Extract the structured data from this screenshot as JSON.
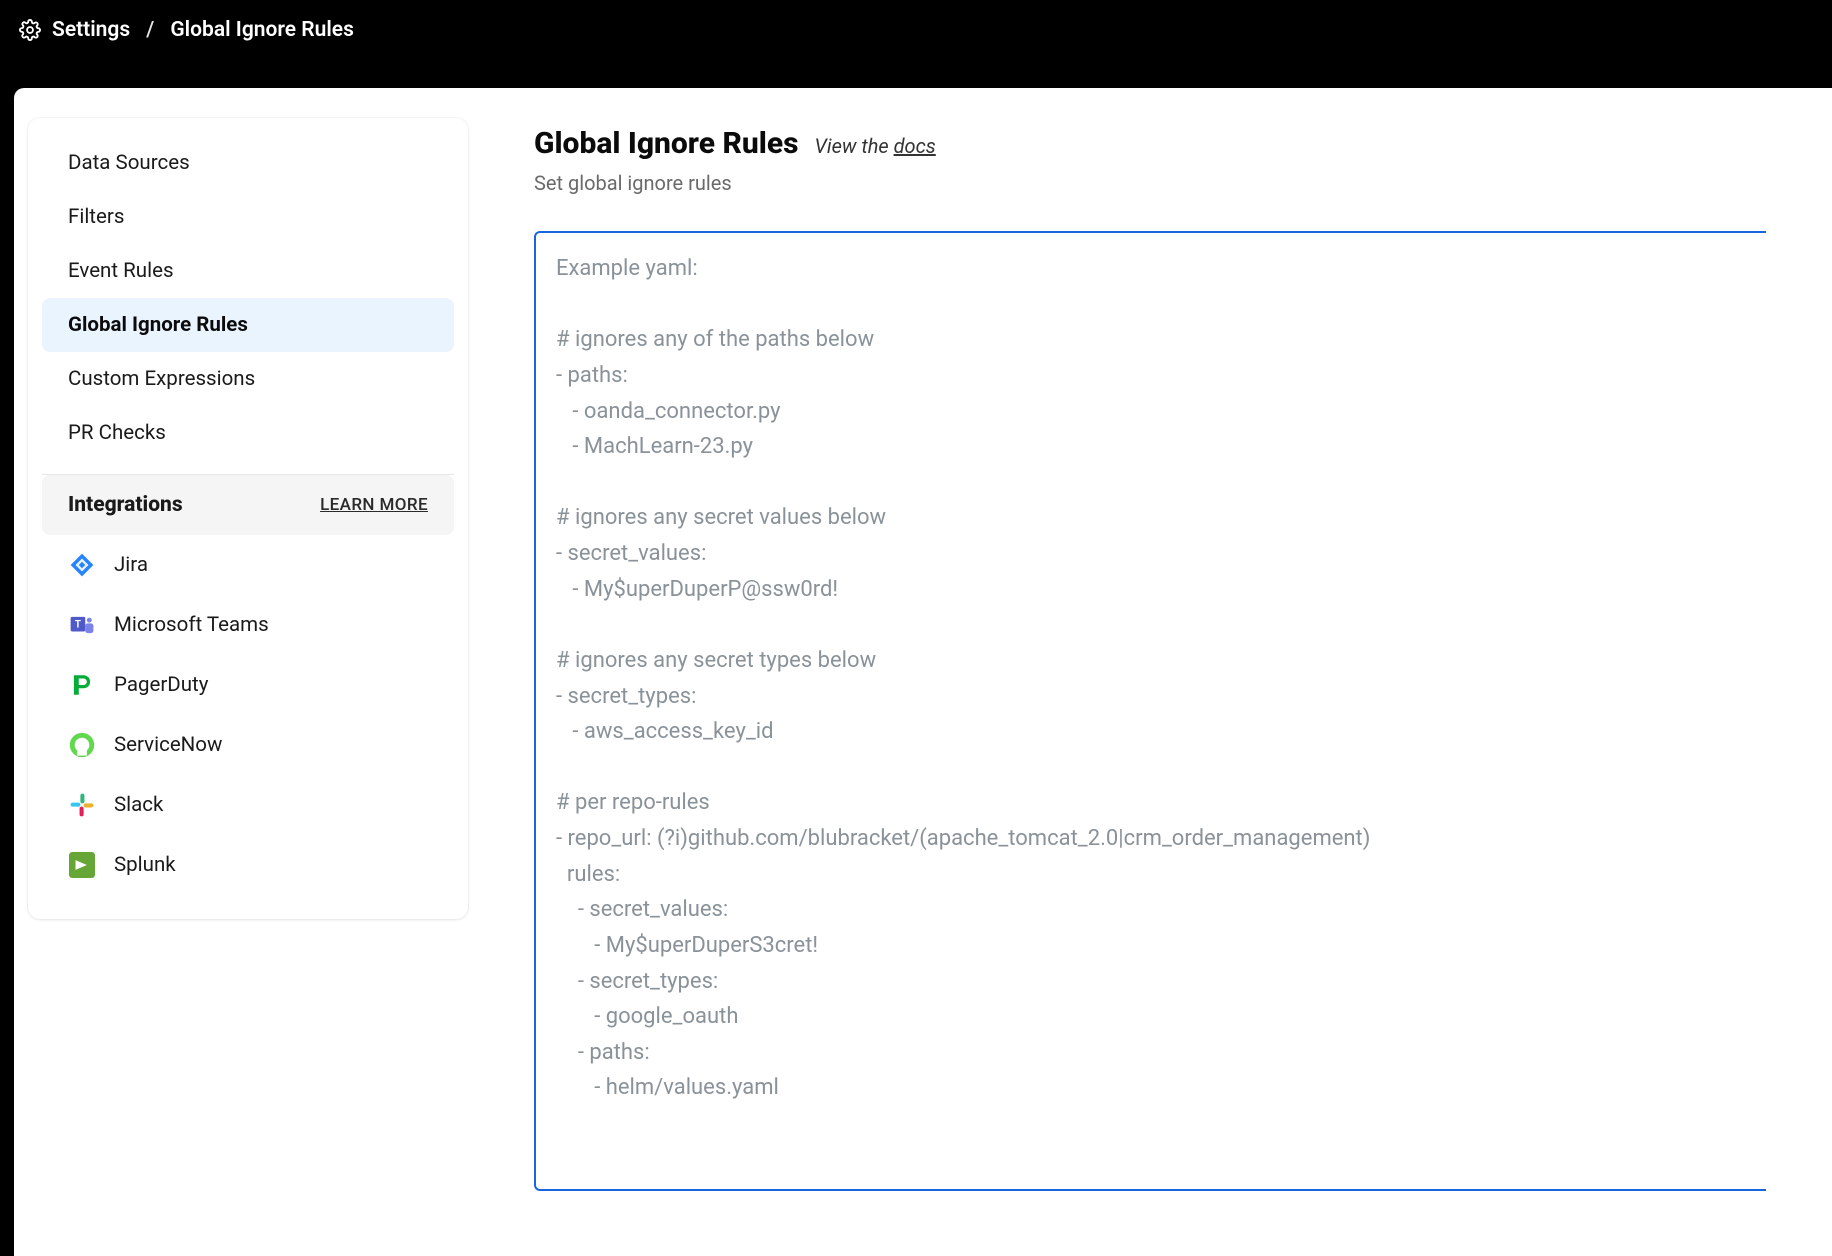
{
  "breadcrumb": {
    "root": "Settings",
    "sep": "/",
    "current": "Global Ignore Rules"
  },
  "sidebar": {
    "items": [
      {
        "label": "Data Sources",
        "active": false
      },
      {
        "label": "Filters",
        "active": false
      },
      {
        "label": "Event Rules",
        "active": false
      },
      {
        "label": "Global Ignore Rules",
        "active": true
      },
      {
        "label": "Custom Expressions",
        "active": false
      },
      {
        "label": "PR Checks",
        "active": false
      }
    ],
    "integrations_header": "Integrations",
    "learn_more": "LEARN MORE",
    "integrations": [
      {
        "id": "jira",
        "label": "Jira"
      },
      {
        "id": "teams",
        "label": "Microsoft Teams"
      },
      {
        "id": "pagerduty",
        "label": "PagerDuty"
      },
      {
        "id": "servicenow",
        "label": "ServiceNow"
      },
      {
        "id": "slack",
        "label": "Slack"
      },
      {
        "id": "splunk",
        "label": "Splunk"
      }
    ]
  },
  "main": {
    "title": "Global Ignore Rules",
    "docs_prefix": "View the ",
    "docs_link": "docs",
    "subtitle": "Set global ignore rules",
    "yaml_placeholder": "Example yaml:\n\n# ignores any of the paths below\n- paths:\n   - oanda_connector.py\n   - MachLearn-23.py\n\n# ignores any secret values below\n- secret_values:\n   - My$uperDuperP@ssw0rd!\n\n# ignores any secret types below\n- secret_types:\n   - aws_access_key_id\n\n# per repo-rules\n- repo_url: (?i)github.com/blubracket/(apache_tomcat_2.0|crm_order_management)\n  rules:\n    - secret_values:\n       - My$uperDuperS3cret!\n    - secret_types:\n       - google_oauth\n    - paths:\n       - helm/values.yaml"
  }
}
